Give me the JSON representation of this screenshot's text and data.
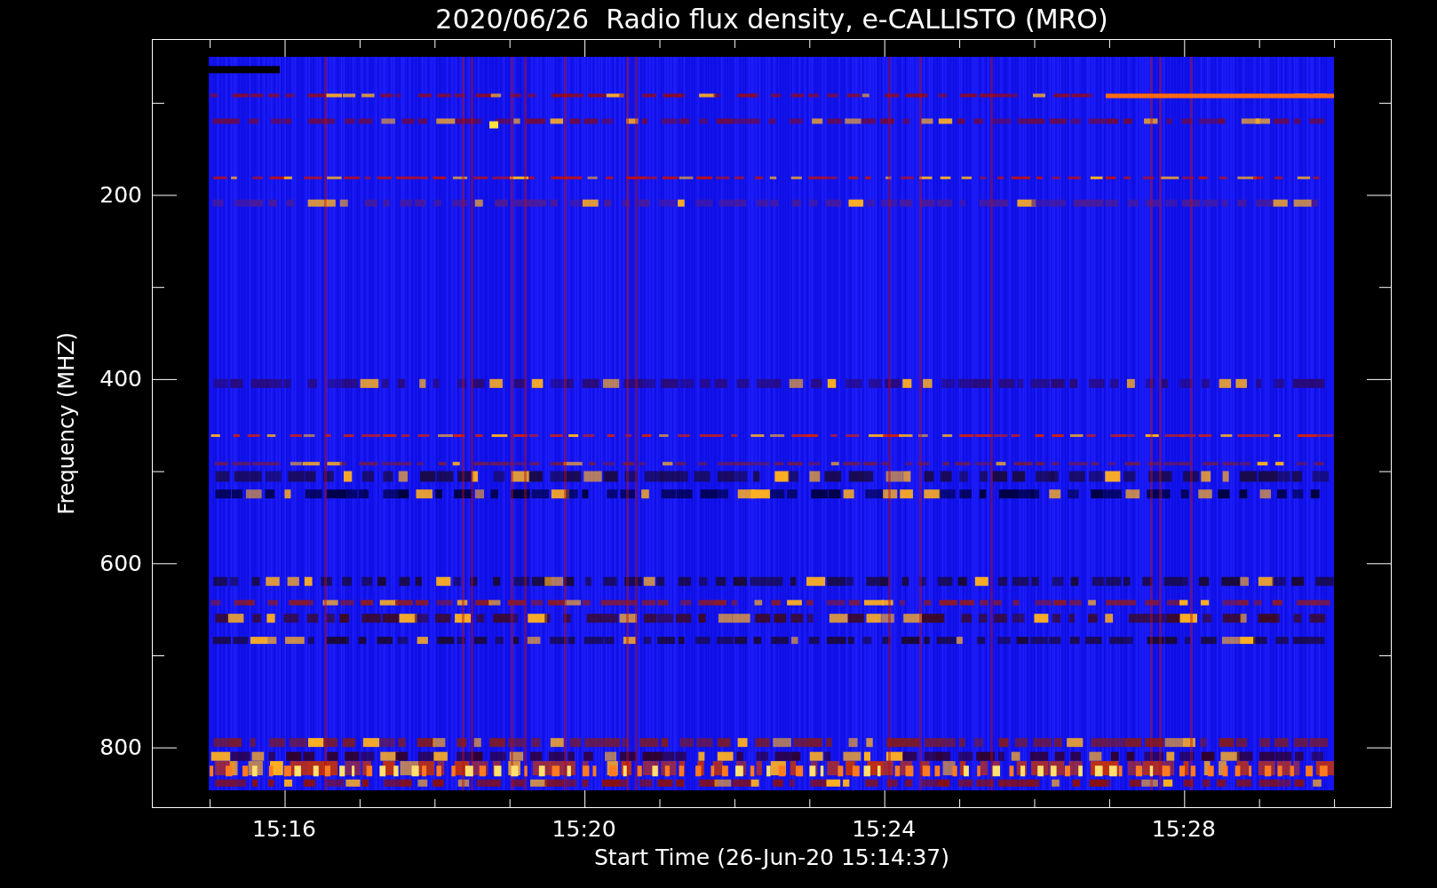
{
  "title": "2020/06/26  Radio flux density, e-CALLISTO (MRO)",
  "y_axis": {
    "label": "Frequency (MHZ)",
    "ticks": [
      "200",
      "400",
      "600",
      "800"
    ]
  },
  "x_axis": {
    "label": "Start Time (26-Jun-20 15:14:37)",
    "ticks": [
      "15:16",
      "15:20",
      "15:24",
      "15:28"
    ]
  }
}
